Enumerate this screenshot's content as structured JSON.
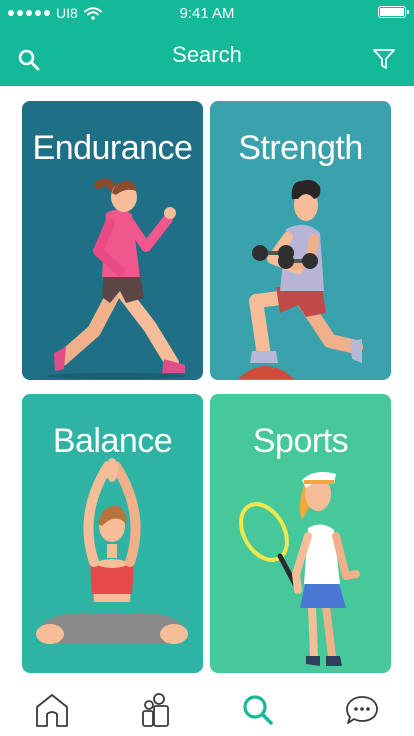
{
  "status_bar": {
    "carrier": "UI8",
    "time": "9:41 AM"
  },
  "header": {
    "title": "Search"
  },
  "cards": [
    {
      "label": "Endurance",
      "color": "#1f6f86"
    },
    {
      "label": "Strength",
      "color": "#3aa2ad"
    },
    {
      "label": "Balance",
      "color": "#2fb3a4"
    },
    {
      "label": "Sports",
      "color": "#47c89b"
    }
  ],
  "tab_bar": {
    "items": [
      {
        "icon": "home-icon"
      },
      {
        "icon": "people-icon"
      },
      {
        "icon": "search-icon",
        "active": true
      },
      {
        "icon": "chat-icon"
      }
    ],
    "active_color": "#13b998"
  }
}
